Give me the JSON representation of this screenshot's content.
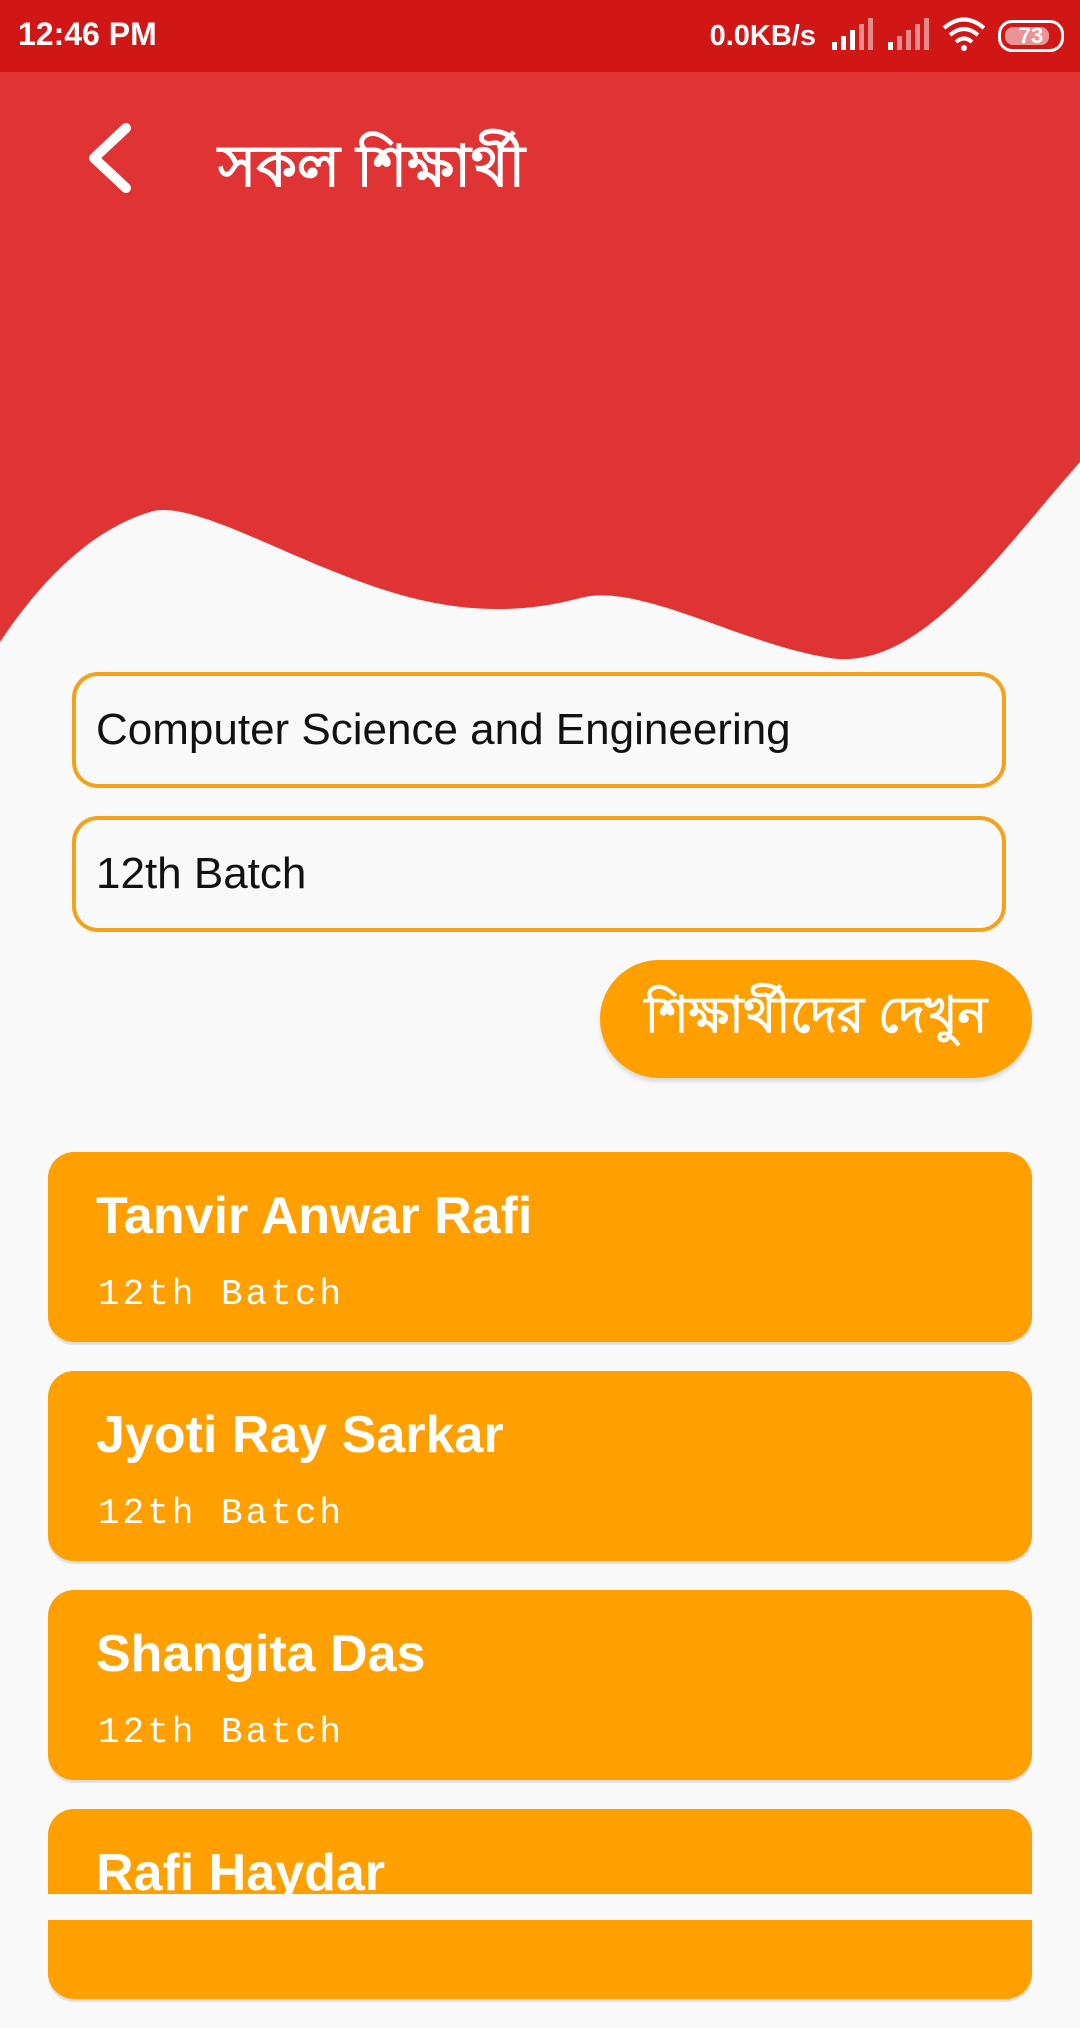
{
  "status_bar": {
    "time": "12:46 PM",
    "network_speed": "0.0KB/s",
    "battery_level": "73",
    "icons": [
      "signal-icon",
      "signal-icon",
      "wifi-icon",
      "battery-icon"
    ]
  },
  "header": {
    "title": "সকল শিক্ষার্থী",
    "back_icon": "chevron-left-icon",
    "color": "#e03434"
  },
  "filters": {
    "department": "Computer Science and Engineering",
    "batch": "12th Batch"
  },
  "show_button_label": "শিক্ষার্থীদের দেখুন",
  "students": [
    {
      "name": "Tanvir Anwar Rafi",
      "batch": "12th Batch"
    },
    {
      "name": "Jyoti Ray Sarkar",
      "batch": "12th Batch"
    },
    {
      "name": "Shangita Das",
      "batch": "12th Batch"
    },
    {
      "name": "Rafi Haydar",
      "batch": ""
    }
  ],
  "colors": {
    "status_bar": "#d11616",
    "accent": "#ffa000",
    "field_border": "#f3a31b",
    "background": "#f9f9f9"
  }
}
